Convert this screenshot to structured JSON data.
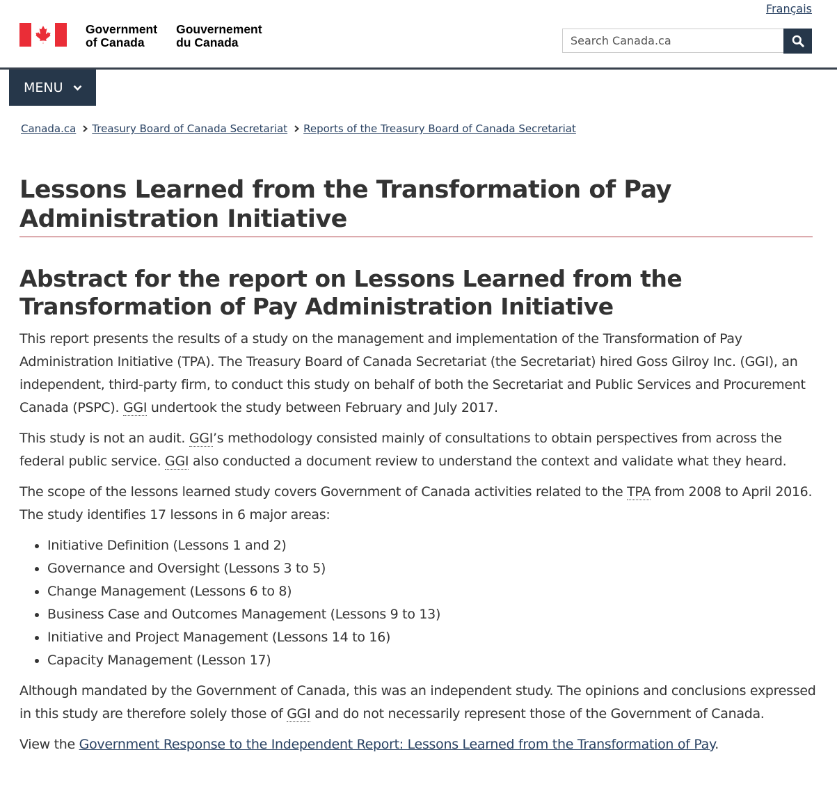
{
  "header": {
    "language_link": "Français",
    "signature_en_line1": "Government",
    "signature_en_line2": "of Canada",
    "signature_fr_line1": "Gouvernement",
    "signature_fr_line2": "du Canada",
    "search_placeholder": "Search Canada.ca",
    "search_icon": "search-icon",
    "flag_color": "#ea2d37",
    "menu_label": "MENU",
    "menu_icon": "chevron-down-icon",
    "nav_color": "#26374a"
  },
  "breadcrumb": [
    {
      "label": "Canada.ca"
    },
    {
      "label": "Treasury Board of Canada Secretariat"
    },
    {
      "label": "Reports of the Treasury Board of Canada Secretariat"
    }
  ],
  "page_title": "Lessons Learned from the Transformation of Pay Administration Initiative",
  "section_title": "Abstract for the report on Lessons Learned from the Transformation of Pay Administration Initiative",
  "paragraphs": {
    "p1_a": "This report presents the results of a study on the management and implementation of the Transformation of Pay Administration Initiative (TPA). The Treasury Board of Canada Secretariat (the Secretariat) hired Goss Gilroy Inc. (GGI), an independent, third-party firm, to conduct this study on behalf of both the Secretariat and Public Services and Procurement Canada (PSPC). ",
    "p1_abbr": "GGI",
    "p1_b": " undertook the study between February and July 2017.",
    "p2_a": "This study is not an audit. ",
    "p2_abbr1": "GGI",
    "p2_b": "’s methodology consisted mainly of consultations to obtain perspectives from across the federal public service. ",
    "p2_abbr2": "GGI",
    "p2_c": " also conducted a document review to understand the context and validate what they heard.",
    "p3_a": "The scope of the lessons learned study covers Government of Canada activities related to the ",
    "p3_abbr": "TPA",
    "p3_b": " from 2008 to April 2016. The study identifies 17 lessons in 6 major areas:",
    "p4_a": "Although mandated by the Government of Canada, this was an independent study. The opinions and conclusions expressed in this study are therefore solely those of ",
    "p4_abbr": "GGI",
    "p4_b": " and do not necessarily represent those of the Government of Canada.",
    "p5_a": "View the ",
    "p5_link": "Government Response to the Independent Report: Lessons Learned from the Transformation of Pay",
    "p5_b": "."
  },
  "lessons": [
    "Initiative Definition (Lessons 1 and 2)",
    "Governance and Oversight (Lessons 3 to 5)",
    "Change Management (Lessons 6 to 8)",
    "Business Case and Outcomes Management (Lessons 9 to 13)",
    "Initiative and Project Management (Lessons 14 to 16)",
    "Capacity Management (Lesson 17)"
  ]
}
